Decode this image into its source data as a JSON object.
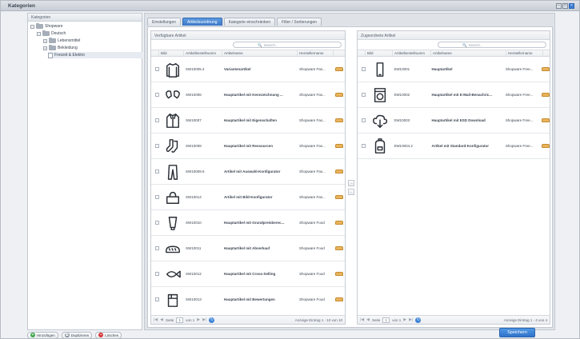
{
  "window": {
    "title": "Kategorien"
  },
  "sidebar": {
    "header": "Kategorien",
    "tree": [
      {
        "label": "Shopware"
      },
      {
        "label": "Deutsch"
      },
      {
        "label": "Lebensmittel"
      },
      {
        "label": "Bekleidung"
      },
      {
        "label": "Freizeit & Elektro"
      }
    ]
  },
  "bottom_buttons": {
    "add": "Hinzufügen",
    "duplicate": "Duplizieren",
    "delete": "Löschen"
  },
  "tabs": [
    "Einstellungen",
    "Artikelzuordnung",
    "Kategorie einschränken",
    "Filter / Sortierungen"
  ],
  "left_panel": {
    "title": "Verfügbare Artikel",
    "search_placeholder": "Search...",
    "columns": [
      "Bild",
      "Artikelbestellnumm",
      "Artikelname",
      "Herstellername"
    ],
    "rows": [
      {
        "icon": "sweater-icon",
        "number": "SW10005.4",
        "name": "Variantenartikel",
        "maker": "Shopware Fas..."
      },
      {
        "icon": "gloves-icon",
        "number": "SW10006",
        "name": "Hauptartikel mit Kennzeichnung ...",
        "maker": "Shopware Fas..."
      },
      {
        "icon": "jacket-icon",
        "number": "SW10007",
        "name": "Hauptartikel mit Eigenschaften",
        "maker": "Shopware Fas..."
      },
      {
        "icon": "socks-icon",
        "number": "SW10008",
        "name": "Hauptartikel mit Ressourcen",
        "maker": "Shopware Fas..."
      },
      {
        "icon": "trousers-icon",
        "number": "SW10009.6",
        "name": "Artikel mit Auswahl-Konfigurator",
        "maker": "Shopware Fas..."
      },
      {
        "icon": "bag-icon",
        "number": "SW10014",
        "name": "Artikel mit Bild-Konfigurator",
        "maker": "Shopware Fas..."
      },
      {
        "icon": "tube-icon",
        "number": "SW10010",
        "name": "Hauptartikel mit Grundpreisberec...",
        "maker": "Shopware Food"
      },
      {
        "icon": "bread-icon",
        "number": "SW10011",
        "name": "Hauptartikel mit Abverkauf",
        "maker": "Shopware Food"
      },
      {
        "icon": "fish-icon",
        "number": "SW10012",
        "name": "Hauptartikel mit Cross-Selling",
        "maker": "Shopware Food"
      },
      {
        "icon": "box-icon",
        "number": "SW10013",
        "name": "Hauptartikel mit Bewertungen",
        "maker": "Shopware Food"
      }
    ],
    "paging": {
      "page_label": "Seite",
      "page": "1",
      "of": "von 1",
      "info": "Anzeige Eintrag 1 - 10 von 10"
    }
  },
  "right_panel": {
    "title": "Zugeordnete Artikel",
    "search_placeholder": "Search...",
    "columns": [
      "Bild",
      "Artikelbestellnumm",
      "Artikelname",
      "Herstellername"
    ],
    "rows": [
      {
        "icon": "phone-icon",
        "number": "SW10001",
        "name": "Hauptartikel",
        "maker": "Shopware Free..."
      },
      {
        "icon": "washing-machine-icon",
        "number": "SW10002",
        "name": "Hauptartikel mit E-Mail-Benachric...",
        "maker": "Shopware Free..."
      },
      {
        "icon": "cloud-download-icon",
        "number": "SW10003",
        "name": "Hauptartikel mit ESD Download",
        "maker": "Shopware Free..."
      },
      {
        "icon": "backpack-icon",
        "number": "SW10004.2",
        "name": "Artikel mit Standard-Konfigurator",
        "maker": "Shopware Free..."
      }
    ],
    "paging": {
      "page_label": "Seite",
      "page": "1",
      "of": "von 1",
      "info": "Anzeige Eintrag 1 - 4 von 4"
    }
  },
  "save_button": "Speichern"
}
